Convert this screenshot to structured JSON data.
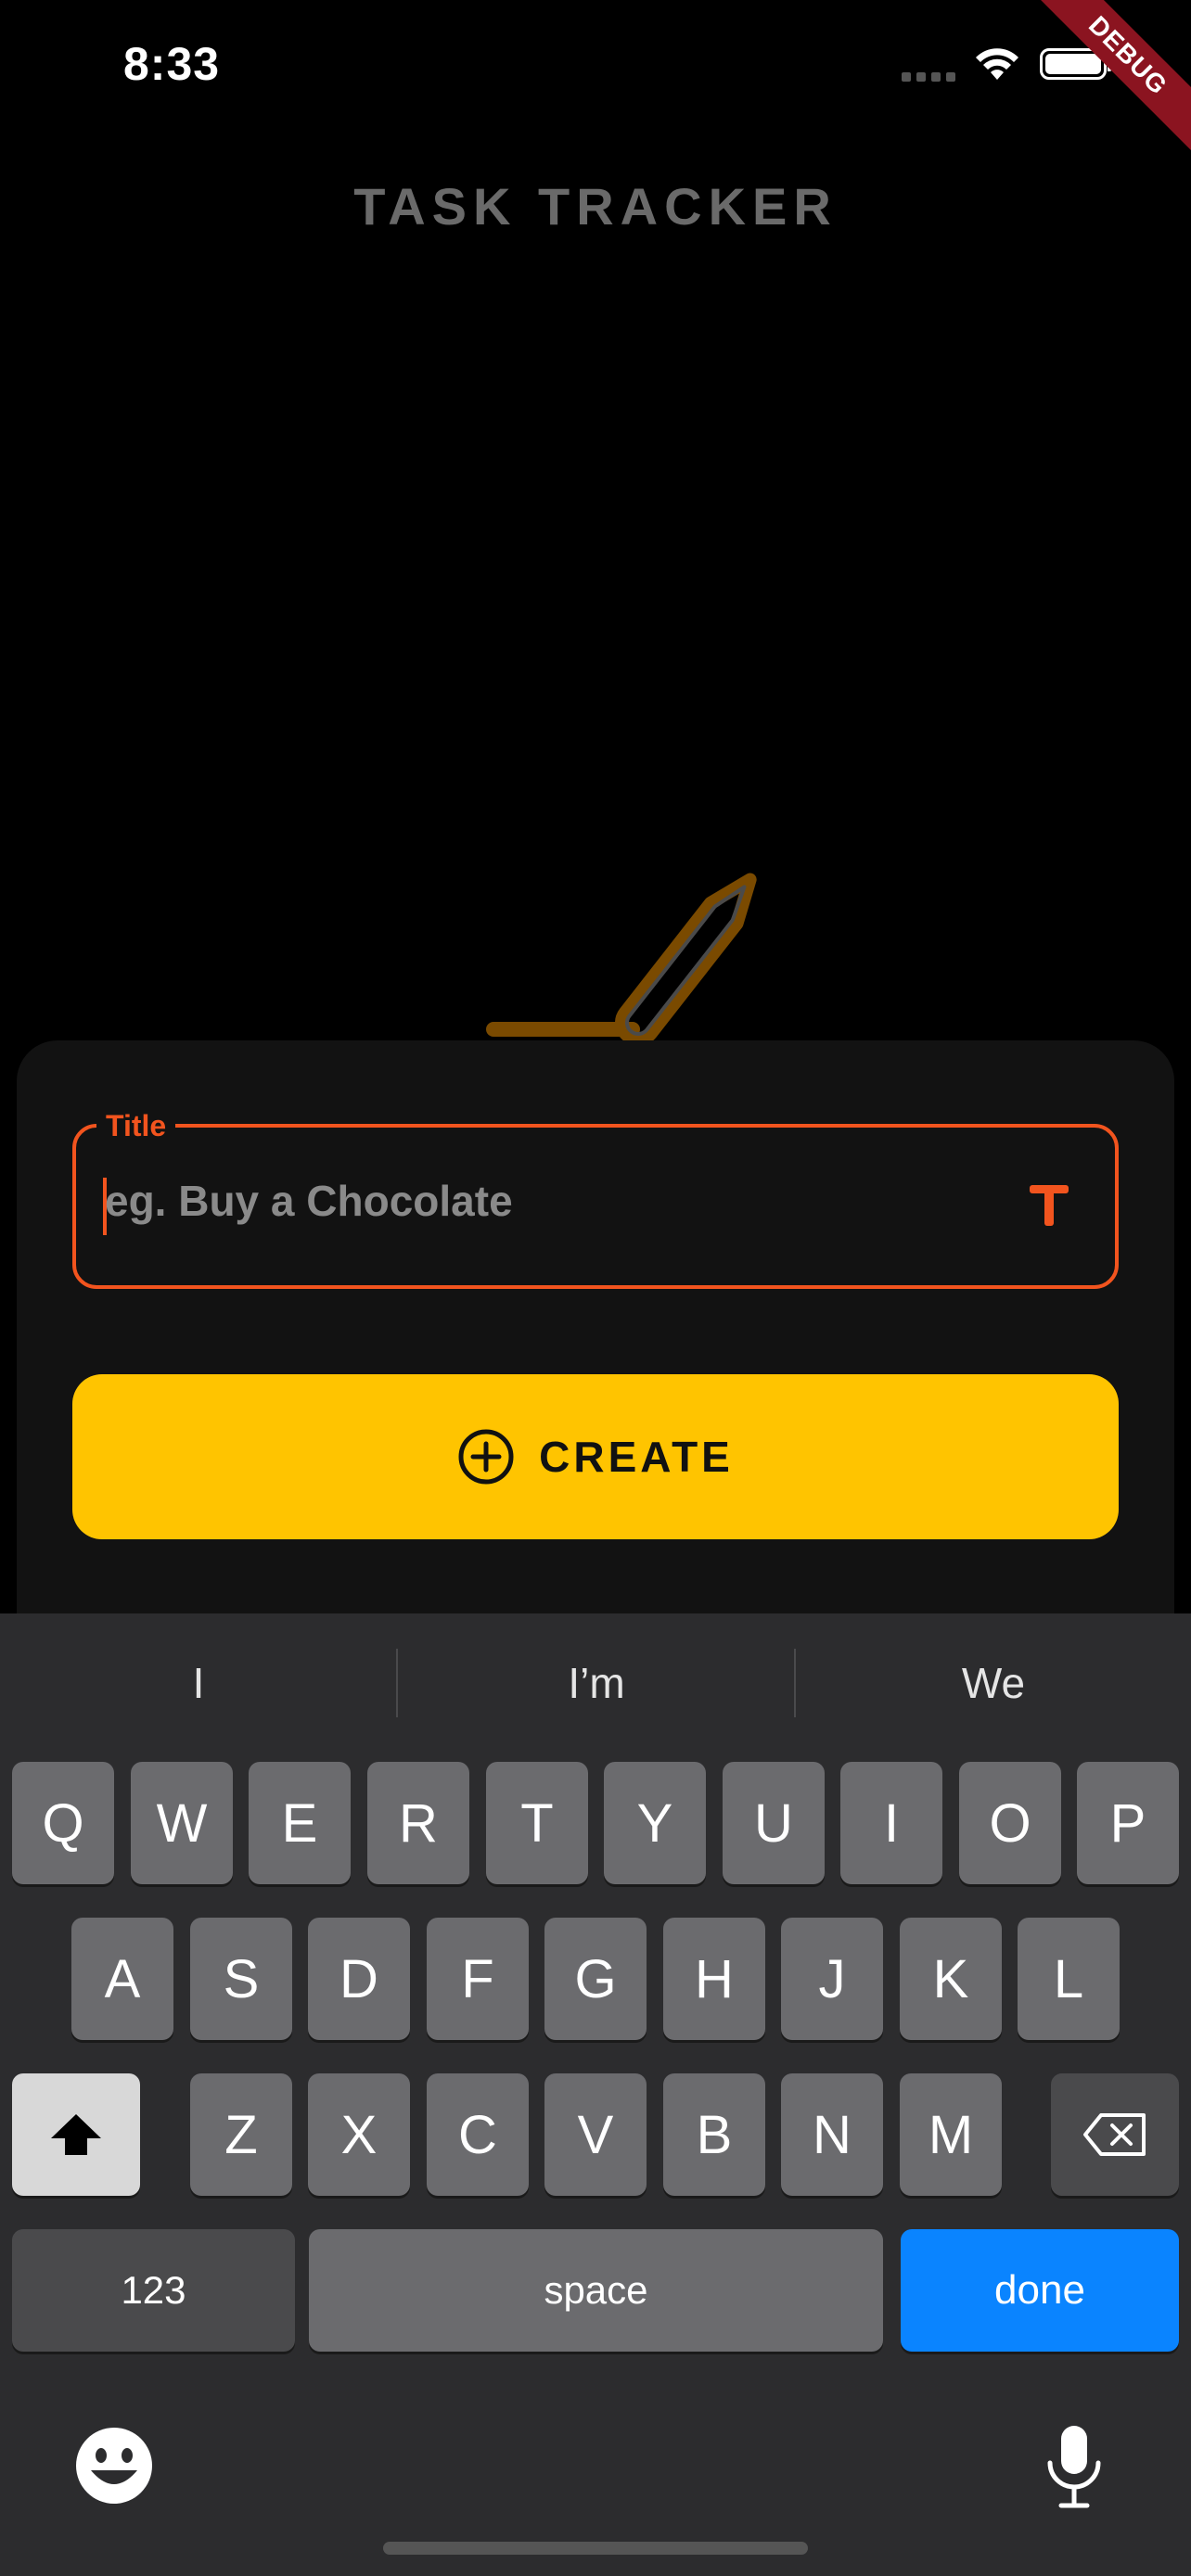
{
  "status_bar": {
    "time": "8:33"
  },
  "debug_banner": "DEBUG",
  "app": {
    "title": "TASK TRACKER"
  },
  "form": {
    "title_label": "Title",
    "title_placeholder": "eg. Buy a Chocolate",
    "create_label": "CREATE"
  },
  "keyboard": {
    "suggestions": [
      "I",
      "I’m",
      "We"
    ],
    "row1": [
      "Q",
      "W",
      "E",
      "R",
      "T",
      "Y",
      "U",
      "I",
      "O",
      "P"
    ],
    "row2": [
      "A",
      "S",
      "D",
      "F",
      "G",
      "H",
      "J",
      "K",
      "L"
    ],
    "row3": [
      "Z",
      "X",
      "C",
      "V",
      "B",
      "N",
      "M"
    ],
    "numbers_label": "123",
    "space_label": "space",
    "done_label": "done"
  },
  "colors": {
    "accent": "#f2541e",
    "button": "#ffc400",
    "done_key": "#0a84ff",
    "illustration": "#7a4a00"
  },
  "icons": [
    "wifi-icon",
    "battery-icon",
    "pencil-icon",
    "text-icon",
    "add-circle-icon",
    "shift-icon",
    "backspace-icon",
    "emoji-icon",
    "microphone-icon"
  ]
}
